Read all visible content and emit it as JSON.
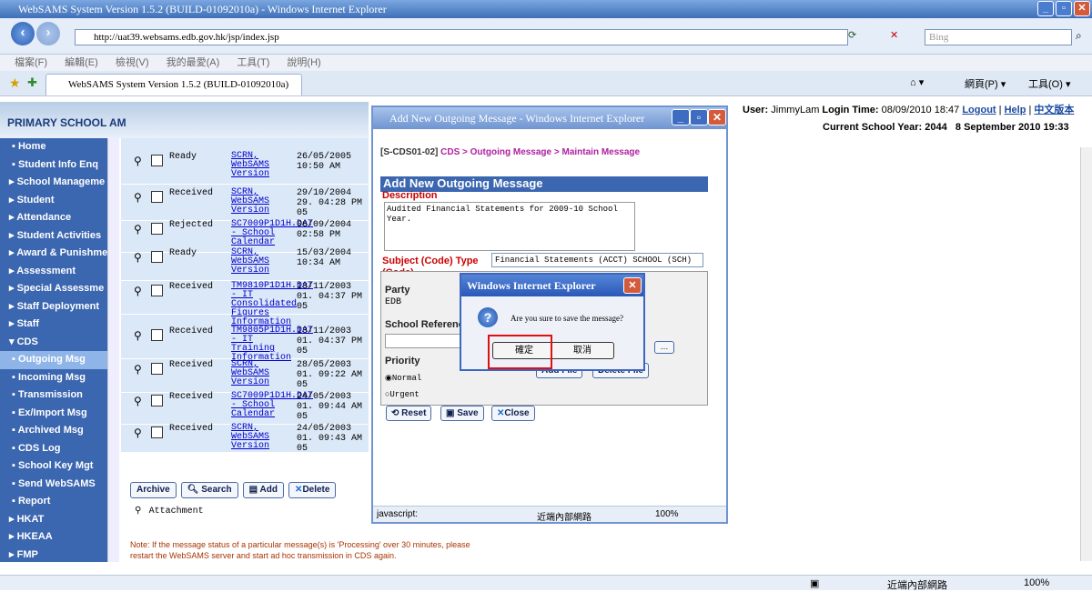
{
  "browser": {
    "title": "WebSAMS System Version 1.5.2 (BUILD-01092010a) - Windows Internet Explorer",
    "url": "http://uat39.websams.edb.gov.hk/jsp/index.jsp",
    "search_placeholder": "Bing",
    "menu": [
      "檔案(F)",
      "編輯(E)",
      "檢視(V)",
      "我的最愛(A)",
      "工具(T)",
      "說明(H)"
    ],
    "tab_title": "WebSAMS System Version 1.5.2 (BUILD-01092010a)",
    "toolbar_right": [
      "網頁(P) ▾",
      "工具(O) ▾"
    ],
    "status_zone": "近端內部網路",
    "zoom": "100%"
  },
  "page": {
    "school_title": "PRIMARY SCHOOL AM",
    "user_label": "User:",
    "user": "JimmyLam",
    "login_time_label": "Login Time:",
    "login_time": "08/09/2010 18:47",
    "logout": "Logout",
    "help": "Help",
    "chinese": "中文版本",
    "school_year": "Current School Year: 2044",
    "date_time": "8 September 2010 19:33"
  },
  "sidebar": {
    "items": [
      {
        "label": "Home",
        "bullet": "▪"
      },
      {
        "label": "Student Info Enq",
        "bullet": "▪"
      },
      {
        "label": "School Manageme",
        "bullet": "▸"
      },
      {
        "label": "Student",
        "bullet": "▸"
      },
      {
        "label": "Attendance",
        "bullet": "▸"
      },
      {
        "label": "Student Activities",
        "bullet": "▸"
      },
      {
        "label": "Award & Punishme",
        "bullet": "▸"
      },
      {
        "label": "Assessment",
        "bullet": "▸"
      },
      {
        "label": "Special Assessme",
        "bullet": "▸"
      },
      {
        "label": "Staff Deployment",
        "bullet": "▸"
      },
      {
        "label": "Staff",
        "bullet": "▸"
      },
      {
        "label": "CDS",
        "bullet": "▾"
      },
      {
        "label": "Outgoing Msg",
        "bullet": "▪"
      },
      {
        "label": "Incoming Msg",
        "bullet": "▪"
      },
      {
        "label": "Transmission",
        "bullet": "▪"
      },
      {
        "label": "Ex/Import Msg",
        "bullet": "▪"
      },
      {
        "label": "Archived Msg",
        "bullet": "▪"
      },
      {
        "label": "CDS Log",
        "bullet": "▪"
      },
      {
        "label": "School Key Mgt",
        "bullet": "▪"
      },
      {
        "label": "Send WebSAMS",
        "bullet": "▪"
      },
      {
        "label": "Report",
        "bullet": "▪"
      },
      {
        "label": "HKAT",
        "bullet": "▸"
      },
      {
        "label": "HKEAA",
        "bullet": "▸"
      },
      {
        "label": "FMP",
        "bullet": "▸"
      }
    ]
  },
  "messages": [
    {
      "status": "Ready",
      "file": "SCRN, WebSAMS Version",
      "date": "26/05/2005 10:50 AM"
    },
    {
      "status": "Received",
      "file": "SCRN, WebSAMS Version",
      "date": "29/10/2004 29. 04:28 PM 05"
    },
    {
      "status": "Rejected",
      "file": "SC7009P1D1H.DAT - School Calendar",
      "date": "06/09/2004 02:58 PM"
    },
    {
      "status": "Ready",
      "file": "SCRN, WebSAMS Version",
      "date": "15/03/2004 10:34 AM"
    },
    {
      "status": "Received",
      "file": "TM9810P1D1H.DAT - IT Consolidated Figures Information",
      "date": "13/11/2003 01. 04:37 PM 05"
    },
    {
      "status": "Received",
      "file": "TM9805P1D1H.DAT - IT Training Information",
      "date": "13/11/2003 01. 04:37 PM 05"
    },
    {
      "status": "Received",
      "file": "SCRN, WebSAMS Version",
      "date": "28/05/2003 01. 09:22 AM 05"
    },
    {
      "status": "Received",
      "file": "SC7009P1D1H.DAT - School Calendar",
      "date": "24/05/2003 01. 09:44 AM 05"
    },
    {
      "status": "Received",
      "file": "SCRN, WebSAMS Version",
      "date": "24/05/2003 01. 09:43 AM 05"
    }
  ],
  "list_buttons": {
    "archive": "Archive",
    "search": "Search",
    "add": "Add",
    "delete": "Delete"
  },
  "attachment_label": "Attachment",
  "note": "Note: If the message status of a particular message(s) is 'Processing' over 30 minutes, please restart the WebSAMS server and start ad hoc transmission in CDS again.",
  "popup": {
    "title": "Add New Outgoing Message - Windows Internet Explorer",
    "crumb_code": "[S-CDS01-02]",
    "crumb_link": "CDS > Outgoing Message > Maintain Message",
    "form_title": "Add New Outgoing Message",
    "description_label": "Description",
    "description_value": "Audited Financial Statements for 2009-10 School Year.",
    "subject_label": "Subject (Code) Type",
    "subject_label2": "(Code)",
    "subject_value": "Financial Statements (ACCT) SCHOOL (SCH)",
    "party_label": "Party",
    "party_value": "EDB",
    "school_ref_label": "School Referenc",
    "priority_label": "Priority",
    "normal": "Normal",
    "urgent": "Urgent",
    "add_file": "Add File",
    "delete_file": "Delete File",
    "reset": "Reset",
    "save": "Save",
    "close": "Close",
    "status_left": "javascript:",
    "status_zone": "近端內部網路",
    "zoom": "100%"
  },
  "dialog": {
    "title": "Windows Internet Explorer",
    "message": "Are you sure to save the message?",
    "ok": "確定",
    "cancel": "取消"
  },
  "colors": {
    "sidebar": "#3b66b0",
    "list_bg": "#dbe8f7",
    "highlight": "#e01010"
  }
}
